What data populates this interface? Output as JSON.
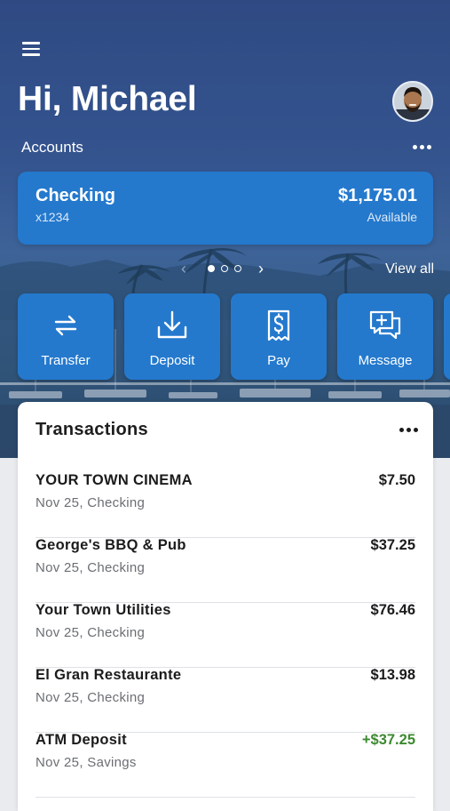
{
  "colors": {
    "accent_blue": "#2479cd",
    "header_blue": "#2f4a83",
    "deposit_green": "#3c8a30",
    "text_dark": "#1b1b1b",
    "text_muted": "#6b6e73"
  },
  "header": {
    "menu_icon": "hamburger-menu-icon",
    "greeting": "Hi, Michael",
    "avatar_icon": "user-avatar-photo"
  },
  "accounts": {
    "label": "Accounts",
    "more_icon": "more-horizontal-icon",
    "card": {
      "name": "Checking",
      "number": "x1234",
      "balance": "$1,175.01",
      "balance_label": "Available"
    },
    "pager": {
      "total": 3,
      "active": 1
    },
    "view_all": "View all"
  },
  "actions": [
    {
      "label": "Transfer",
      "icon": "transfer-arrows-icon"
    },
    {
      "label": "Deposit",
      "icon": "download-tray-icon"
    },
    {
      "label": "Pay",
      "icon": "dollar-receipt-icon"
    },
    {
      "label": "Message",
      "icon": "message-plus-icon"
    }
  ],
  "transactions": {
    "title": "Transactions",
    "more_icon": "more-horizontal-icon",
    "items": [
      {
        "name": "YOUR TOWN CINEMA",
        "sub": "Nov 25, Checking",
        "amount": "$7.50",
        "positive": false
      },
      {
        "name": "George's BBQ & Pub",
        "sub": "Nov 25, Checking",
        "amount": "$37.25",
        "positive": false
      },
      {
        "name": "Your Town Utilities",
        "sub": "Nov 25, Checking",
        "amount": "$76.46",
        "positive": false
      },
      {
        "name": "El Gran Restaurante",
        "sub": "Nov 25, Checking",
        "amount": "$13.98",
        "positive": false
      },
      {
        "name": "ATM Deposit",
        "sub": "Nov 25, Savings",
        "amount": "+$37.25",
        "positive": true
      }
    ]
  }
}
